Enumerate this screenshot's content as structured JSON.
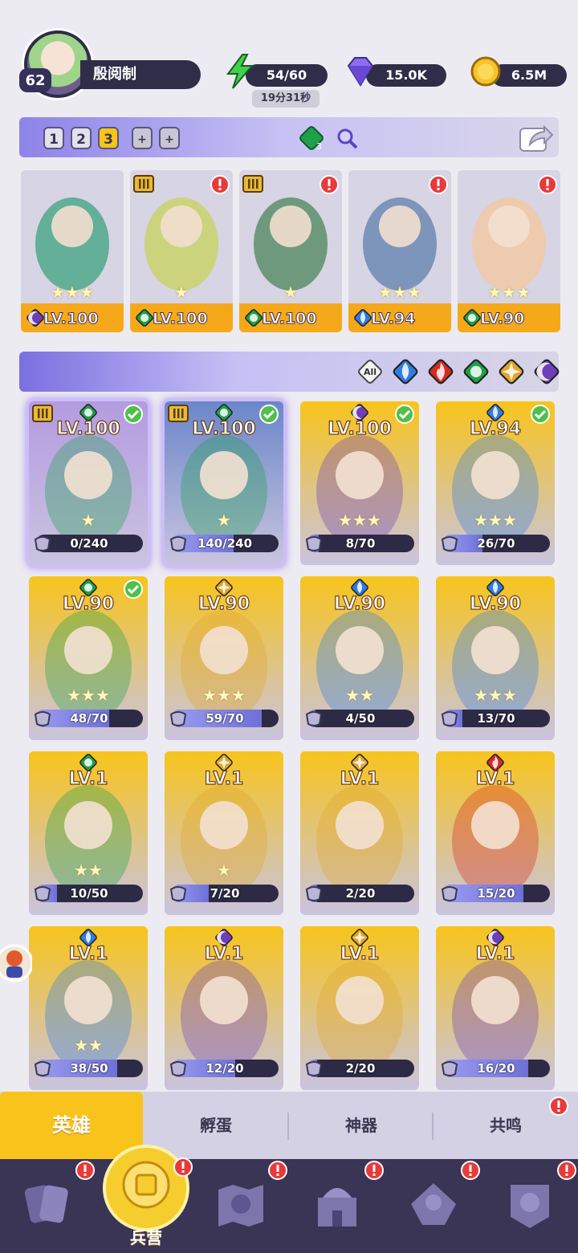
{
  "player": {
    "level": "62",
    "name": "殷阅制"
  },
  "resources": {
    "energy": {
      "value": "54/60",
      "timer": "19分31秒",
      "icon": "lightning-icon"
    },
    "gems": {
      "value": "15.0K",
      "icon": "diamond-icon"
    },
    "gold": {
      "value": "6.5M",
      "icon": "coin-icon"
    }
  },
  "team_tabs": [
    "1",
    "2",
    "3"
  ],
  "team_active": "3",
  "team_badge": "3",
  "team": [
    {
      "lv": "LV.100",
      "element": "dark",
      "stars": "★★★",
      "tier": false,
      "alert": false,
      "color": "#4fa88a"
    },
    {
      "lv": "LV.100",
      "element": "nature",
      "stars": "★",
      "tier": true,
      "alert": true,
      "color": "#c9d26b"
    },
    {
      "lv": "LV.100",
      "element": "nature",
      "stars": "★",
      "tier": true,
      "alert": true,
      "color": "#5d8e6a"
    },
    {
      "lv": "LV.94",
      "element": "water",
      "stars": "★★★",
      "tier": false,
      "alert": true,
      "color": "#6d8ab4"
    },
    {
      "lv": "LV.90",
      "element": "nature",
      "stars": "★★★",
      "tier": false,
      "alert": true,
      "color": "#f2c8a5"
    }
  ],
  "filters": {
    "all_label": "All",
    "items": [
      "all",
      "water",
      "fire",
      "nature",
      "light",
      "dark"
    ]
  },
  "heroes": [
    {
      "lv": "LV.100",
      "element": "nature",
      "progress": "0/240",
      "pct": 0,
      "stars": "★",
      "tier": true,
      "check": true,
      "selected": true,
      "color": "#b49be0"
    },
    {
      "lv": "LV.100",
      "element": "nature",
      "progress": "140/240",
      "pct": 0.58,
      "stars": "★",
      "tier": true,
      "check": true,
      "selected": true,
      "color": "#6b86c9"
    },
    {
      "lv": "LV.100",
      "element": "dark",
      "progress": "8/70",
      "pct": 0.11,
      "stars": "★★★",
      "tier": false,
      "check": true,
      "selected": false,
      "color": "#f1c83a"
    },
    {
      "lv": "LV.94",
      "element": "water",
      "progress": "26/70",
      "pct": 0.37,
      "stars": "★★★",
      "tier": false,
      "check": true,
      "selected": false,
      "color": "#f1c83a"
    },
    {
      "lv": "LV.90",
      "element": "nature",
      "progress": "48/70",
      "pct": 0.69,
      "stars": "★★★",
      "tier": false,
      "check": true,
      "selected": false,
      "color": "#f1c83a"
    },
    {
      "lv": "LV.90",
      "element": "light",
      "progress": "59/70",
      "pct": 0.84,
      "stars": "★★★",
      "tier": false,
      "check": false,
      "selected": false,
      "color": "#f1c83a"
    },
    {
      "lv": "LV.90",
      "element": "water",
      "progress": "4/50",
      "pct": 0.08,
      "stars": "★★",
      "tier": false,
      "check": false,
      "selected": false,
      "color": "#f1c83a"
    },
    {
      "lv": "LV.90",
      "element": "water",
      "progress": "13/70",
      "pct": 0.19,
      "stars": "★★★",
      "tier": false,
      "check": false,
      "selected": false,
      "color": "#f1c83a"
    },
    {
      "lv": "LV.1",
      "element": "nature",
      "progress": "10/50",
      "pct": 0.2,
      "stars": "★★",
      "tier": false,
      "check": false,
      "selected": false,
      "color": "#f1c83a"
    },
    {
      "lv": "LV.1",
      "element": "light",
      "progress": "7/20",
      "pct": 0.35,
      "stars": "★",
      "tier": false,
      "check": false,
      "selected": false,
      "color": "#f1c83a"
    },
    {
      "lv": "LV.1",
      "element": "light",
      "progress": "2/20",
      "pct": 0.1,
      "stars": "",
      "tier": false,
      "check": false,
      "selected": false,
      "color": "#f1c83a"
    },
    {
      "lv": "LV.1",
      "element": "fire",
      "progress": "15/20",
      "pct": 0.75,
      "stars": "",
      "tier": false,
      "check": false,
      "selected": false,
      "color": "#f1c83a"
    },
    {
      "lv": "LV.1",
      "element": "water",
      "progress": "38/50",
      "pct": 0.76,
      "stars": "★★",
      "tier": false,
      "check": false,
      "selected": false,
      "color": "#f1c83a"
    },
    {
      "lv": "LV.1",
      "element": "dark",
      "progress": "12/20",
      "pct": 0.6,
      "stars": "",
      "tier": false,
      "check": false,
      "selected": false,
      "color": "#f1c83a"
    },
    {
      "lv": "LV.1",
      "element": "light",
      "progress": "2/20",
      "pct": 0.1,
      "stars": "",
      "tier": false,
      "check": false,
      "selected": false,
      "color": "#f1c83a"
    },
    {
      "lv": "LV.1",
      "element": "dark",
      "progress": "16/20",
      "pct": 0.8,
      "stars": "",
      "tier": false,
      "check": false,
      "selected": false,
      "color": "#f1c83a"
    }
  ],
  "subtabs": [
    {
      "label": "英雄",
      "active": true
    },
    {
      "label": "孵蛋",
      "active": false
    },
    {
      "label": "神器",
      "active": false
    },
    {
      "label": "共鸣",
      "active": false
    }
  ],
  "bottom_nav": [
    {
      "name": "cards-nav",
      "label": "",
      "alert": true
    },
    {
      "name": "barracks-nav",
      "label": "兵营",
      "alert": true
    },
    {
      "name": "map-nav",
      "label": "",
      "alert": true
    },
    {
      "name": "castle-nav",
      "label": "",
      "alert": true
    },
    {
      "name": "guild-nav",
      "label": "",
      "alert": true
    },
    {
      "name": "clan-nav",
      "label": "",
      "alert": true
    }
  ],
  "colors": {
    "accent_yellow": "#f8c41c",
    "panel_dark": "#2f2d47",
    "alert_red": "#e83a3a",
    "element": {
      "water": "#2f7de0",
      "fire": "#d8291e",
      "nature": "#1ea04a",
      "light": "#e0a72a",
      "dark": "#6e3fb8"
    }
  }
}
